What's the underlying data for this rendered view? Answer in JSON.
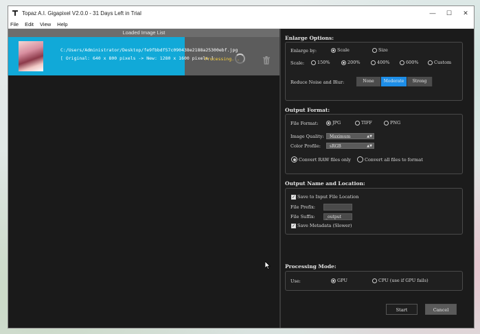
{
  "window": {
    "title": "Topaz A.I. Gigapixel V2.0.0 - 31 Days Left in Trial",
    "controls": {
      "minimize": "—",
      "maximize": "☐",
      "close": "✕"
    }
  },
  "menu": [
    "File",
    "Edit",
    "View",
    "Help"
  ],
  "image_list": {
    "header": "Loaded Image List",
    "items": [
      {
        "path": "C:/Users/Administrator/Desktop/fe9fbbdf57c090438e2188a25300ebf.jpg",
        "info": "[ Original: 640 x 800 pixels -> New: 1280 x 1600 pixels ]",
        "status": "Processing...",
        "progress": 0.65
      }
    ]
  },
  "enlarge": {
    "title": "Enlarge Options:",
    "enlarge_by_label": "Enlarge by:",
    "enlarge_by_options": [
      "Scale",
      "Size"
    ],
    "scale_label": "Scale:",
    "scale_options": [
      "150%",
      "200%",
      "400%",
      "600%",
      "Custom"
    ],
    "noise_label": "Reduce Noise and Blur:",
    "noise_options": [
      "None",
      "Moderate",
      "Strong"
    ]
  },
  "output_format": {
    "title": "Output Format:",
    "file_format_label": "File Format:",
    "file_formats": [
      "JPG",
      "TIFF",
      "PNG"
    ],
    "quality_label": "Image Quality:",
    "quality_value": "Maximum",
    "profile_label": "Color Profile:",
    "profile_value": "sRGB",
    "raw_option_1": "Convert RAW files only",
    "raw_option_2": "Convert all files to format"
  },
  "output_name": {
    "title": "Output Name and Location:",
    "save_to_input": "Save to Input File Location",
    "prefix_label": "File Prefix:",
    "prefix_value": "",
    "suffix_label": "File Suffix:",
    "suffix_value": "_output",
    "save_metadata": "Save Metadata (Slower)"
  },
  "processing": {
    "title": "Processing Mode:",
    "use_label": "Use:",
    "gpu": "GPU",
    "cpu": "CPU (use if GPU fails)"
  },
  "actions": {
    "start": "Start",
    "cancel": "Cancel"
  },
  "colors": {
    "progress": "#11a9d8",
    "accent": "#1d8ee8",
    "status": "#ffd43b"
  }
}
